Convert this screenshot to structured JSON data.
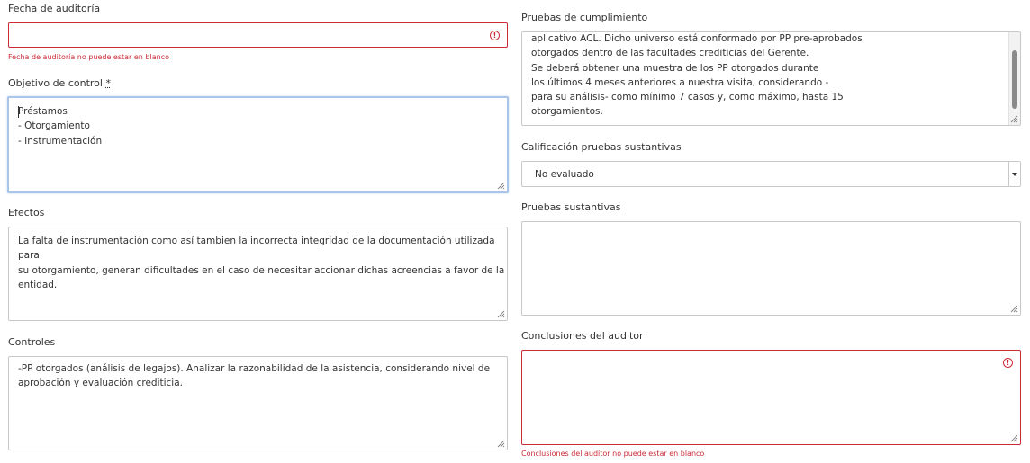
{
  "left": {
    "fecha": {
      "label": "Fecha de auditoría",
      "value": "",
      "error": "Fecha de auditoría no puede estar en blanco"
    },
    "objetivo": {
      "label": "Objetivo de control",
      "required_mark": "*",
      "value": "Préstamos\n- Otorgamiento\n- Instrumentación"
    },
    "efectos": {
      "label": "Efectos",
      "value": "La falta de instrumentación como así tambien la incorrecta integridad de la documentación utilizada para\nsu otorgamiento, generan dificultades en el caso de necesitar accionar dichas acreencias a favor de la\nentidad."
    },
    "controles": {
      "label": "Controles",
      "value": "-PP otorgados (análisis de legajos). Analizar la razonabilidad de la asistencia, considerando nivel de\naprobación y evaluación crediticia."
    }
  },
  "right": {
    "pruebas_cumplimiento": {
      "label": "Pruebas de cumplimiento",
      "value": "aplicativo ACL. Dicho universo está conformado por PP pre-aprobados\notorgados dentro de las facultades crediticias del Gerente.\nSe deberá obtener una muestra de los PP otorgados durante\nlos últimos 4 meses anteriores a nuestra visita, considerando -\npara su análisis- como mínimo 7 casos y, como máximo, hasta 15\notorgamientos."
    },
    "calificacion": {
      "label": "Calificación pruebas sustantivas",
      "selected": "No evaluado"
    },
    "pruebas_sustantivas": {
      "label": "Pruebas sustantivas",
      "value": ""
    },
    "conclusiones": {
      "label": "Conclusiones del auditor",
      "value": "",
      "error": "Conclusiones del auditor no puede estar en blanco"
    }
  },
  "icons": {
    "error_glyph": "!",
    "error_color": "#cc2b36",
    "focus_color": "#a9c6ea"
  }
}
